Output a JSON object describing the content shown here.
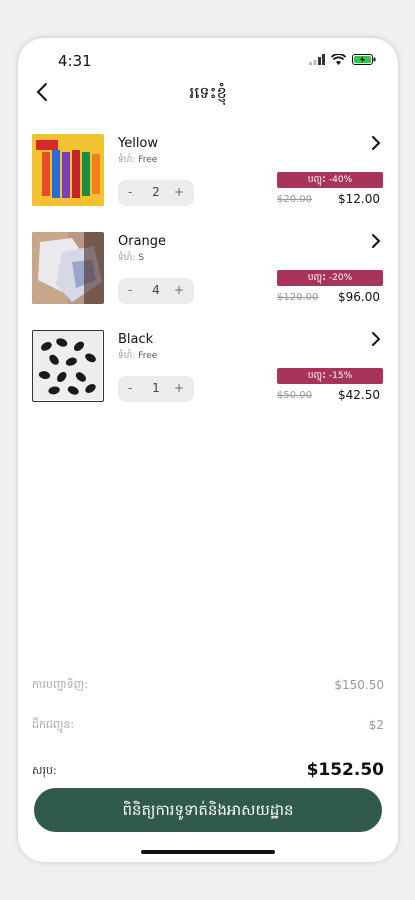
{
  "status": {
    "time": "4:31"
  },
  "nav": {
    "title": "រទេះខ្ញុំ"
  },
  "items": [
    {
      "name": "Yellow",
      "size_label": "ទំហំ:",
      "size": "Free",
      "qty": "2",
      "discount": "បញ្ចុះ -40%",
      "original_price": "$20.00",
      "price": "$12.00"
    },
    {
      "name": "Orange",
      "size_label": "ទំហំ:",
      "size": "S",
      "qty": "4",
      "discount": "បញ្ចុះ -20%",
      "original_price": "$120.00",
      "price": "$96.00"
    },
    {
      "name": "Black",
      "size_label": "ទំហំ:",
      "size": "Free",
      "qty": "1",
      "discount": "បញ្ចុះ -15%",
      "original_price": "$50.00",
      "price": "$42.50"
    }
  ],
  "stepper": {
    "minus": "-",
    "plus": "+"
  },
  "summary": {
    "subtotal_label": "ការបញ្ជាទិញ:",
    "subtotal": "$150.50",
    "delivery_label": "ដឹកជញ្ជូន:",
    "delivery": "$2",
    "total_label": "សរុប:",
    "total": "$152.50"
  },
  "checkout_label": "ពិនិត្យការទូទាត់និងអាសយដ្ឋាន",
  "colors": {
    "badge": "#a8345a",
    "button": "#305a4b"
  }
}
